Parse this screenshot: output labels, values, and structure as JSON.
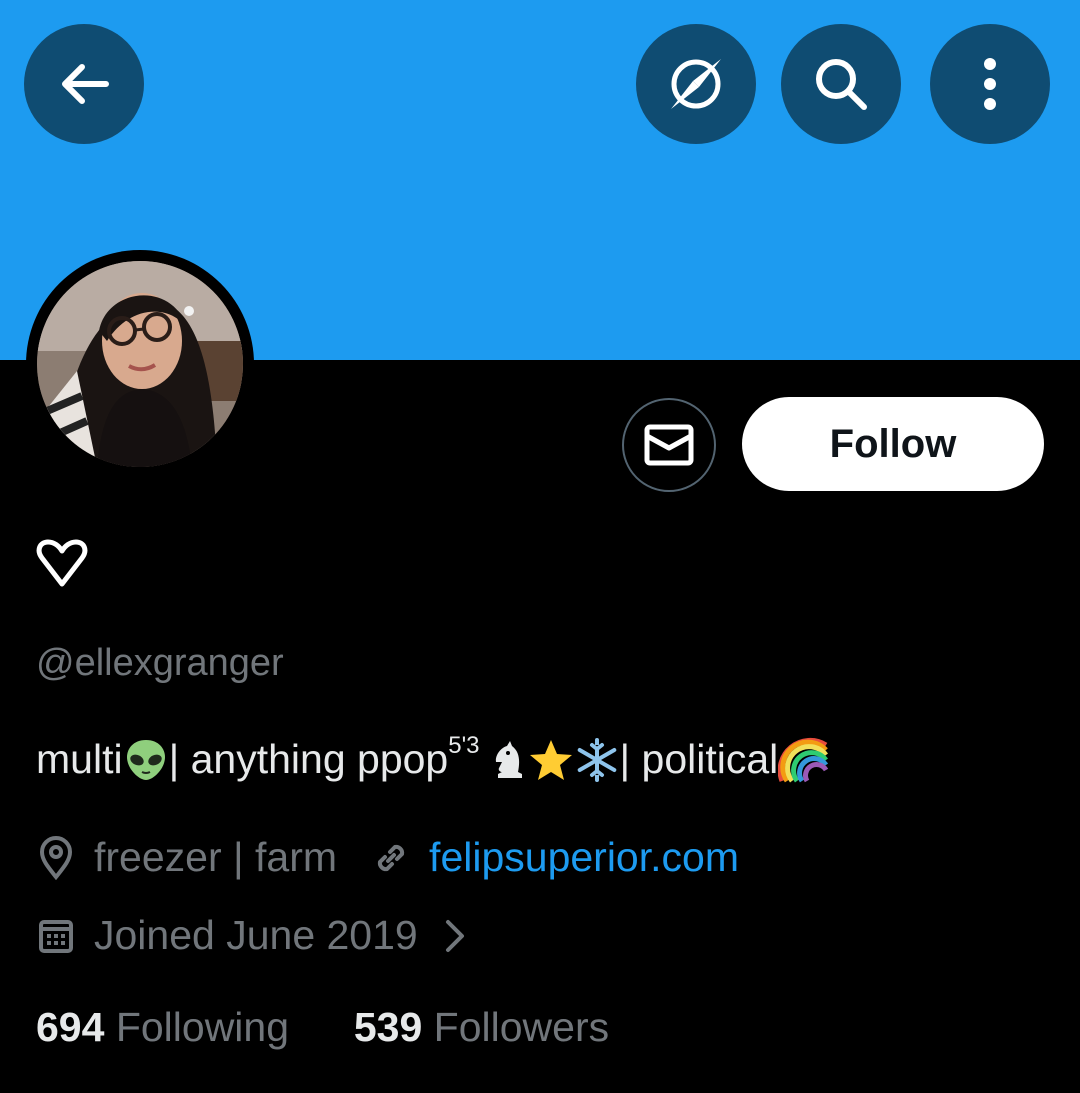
{
  "header": {
    "back_icon": "arrow-left-icon",
    "explore_icon": "compass-icon",
    "search_icon": "search-icon",
    "more_icon": "more-vertical-icon",
    "banner_color": "#1d9bf0"
  },
  "profile": {
    "avatar": "profile-photo",
    "display_name_icon": "heart-outline-icon",
    "handle": "@ellexgranger",
    "bio": {
      "part1": "multi ",
      "part2": " | anything ppop",
      "sup": "5'3",
      "part3": "| political "
    },
    "location": "freezer | farm",
    "website": "felipsuperior.com",
    "joined": "Joined June 2019",
    "following_count": "694",
    "following_label": "Following",
    "followers_count": "539",
    "followers_label": "Followers"
  },
  "actions": {
    "message_icon": "envelope-icon",
    "follow_label": "Follow"
  },
  "colors": {
    "accent": "#1d9bf0",
    "muted": "#71767b",
    "text": "#e7e9ea",
    "background": "#000000"
  }
}
